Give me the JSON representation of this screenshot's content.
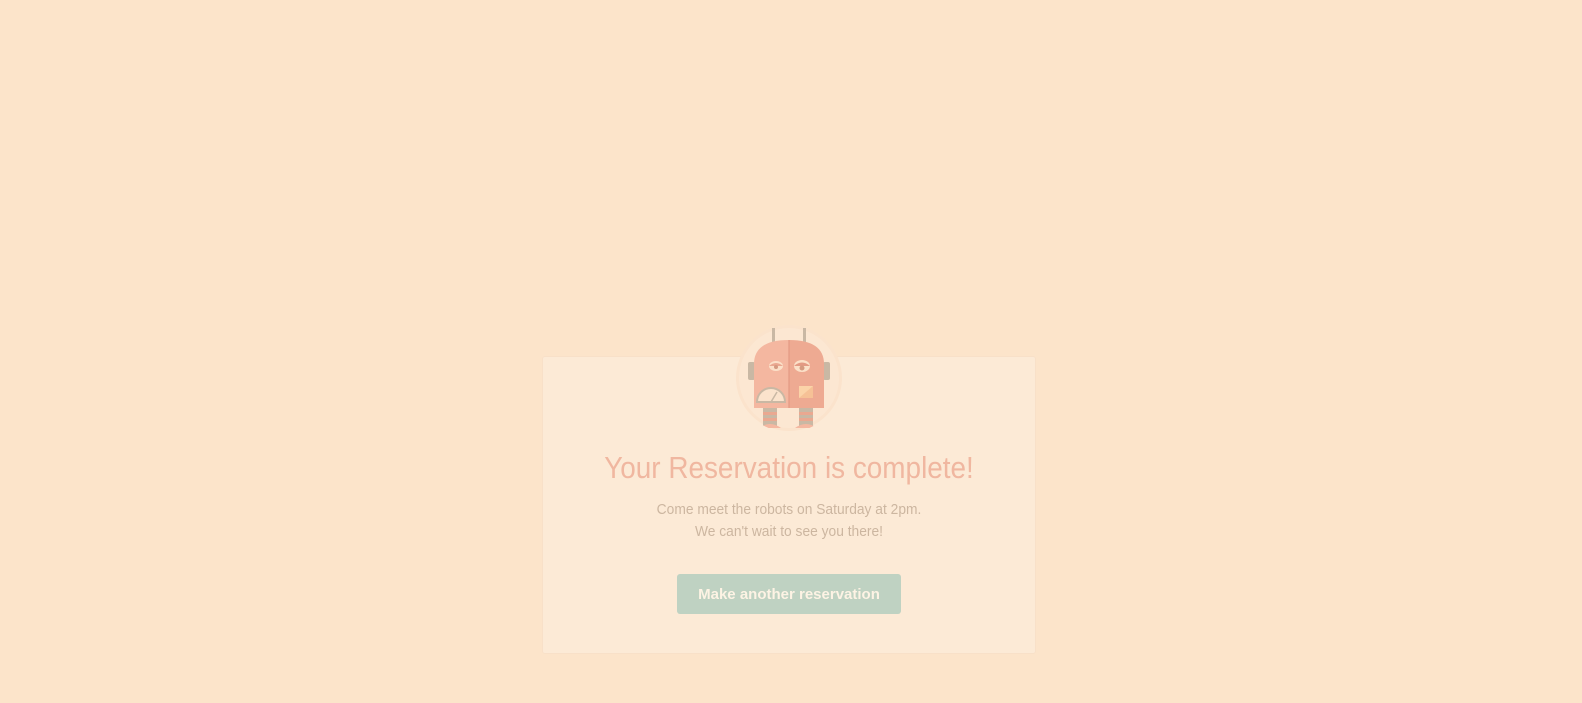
{
  "colors": {
    "page_background": "#fce4ca",
    "card_background": "#fcead6",
    "card_border": "#f8e0c8",
    "title_color": "#f0b7a0",
    "message_color": "#ccb6a0",
    "button_background": "#bfd2c2",
    "button_text": "#fdf3e4",
    "robot_body": "#f4b7a0",
    "robot_shadow": "#eaa890",
    "robot_metal": "#c9b8a4",
    "robot_panel": "#fbd3a8",
    "avatar_ring": "#fbe3cc"
  },
  "avatar": {
    "icon": "robot-icon"
  },
  "confirmation": {
    "title": "Your Reservation is complete!",
    "message_line1": "Come meet the robots on Saturday at 2pm.",
    "message_line2": "We can't wait to see you there!"
  },
  "actions": {
    "make_another_label": "Make another reservation"
  }
}
